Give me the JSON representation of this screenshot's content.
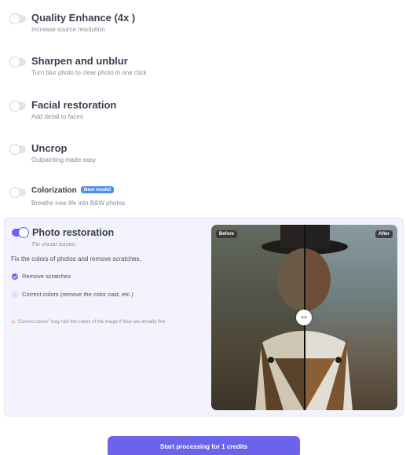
{
  "options": [
    {
      "title": "Quality Enhance (4x )",
      "subtitle": "Increase source resolution",
      "enabled": false
    },
    {
      "title": "Sharpen and unblur",
      "subtitle": "Turn blur photo to clear photo in one click",
      "enabled": false
    },
    {
      "title": "Facial restoration",
      "subtitle": "Add detail to faces",
      "enabled": false
    },
    {
      "title": "Uncrop",
      "subtitle": "Outpainting made easy",
      "enabled": false
    },
    {
      "title": "Colorization",
      "badge": "New model",
      "subtitle": "Breathe new life into B&W photos",
      "enabled": false
    }
  ],
  "photo_restoration": {
    "title": "Photo restoration",
    "subtitle": "Fix visual issues",
    "enabled": true,
    "description": "Fix the colors of photos and remove scratches.",
    "checkbox_remove_scratches": {
      "label": "Remove scratches",
      "checked": true
    },
    "checkbox_correct_colors": {
      "label": "Correct colors (remove the color cast, etc.)",
      "checked": false
    },
    "warning": "\"Correct colors\" may ruin the colors of the image if they are already fine",
    "preview": {
      "before_label": "Before",
      "after_label": "After",
      "handle_icon": "<>"
    }
  },
  "accent_color": "#6d63ea",
  "cta_label": "Start processing for 1 credits"
}
